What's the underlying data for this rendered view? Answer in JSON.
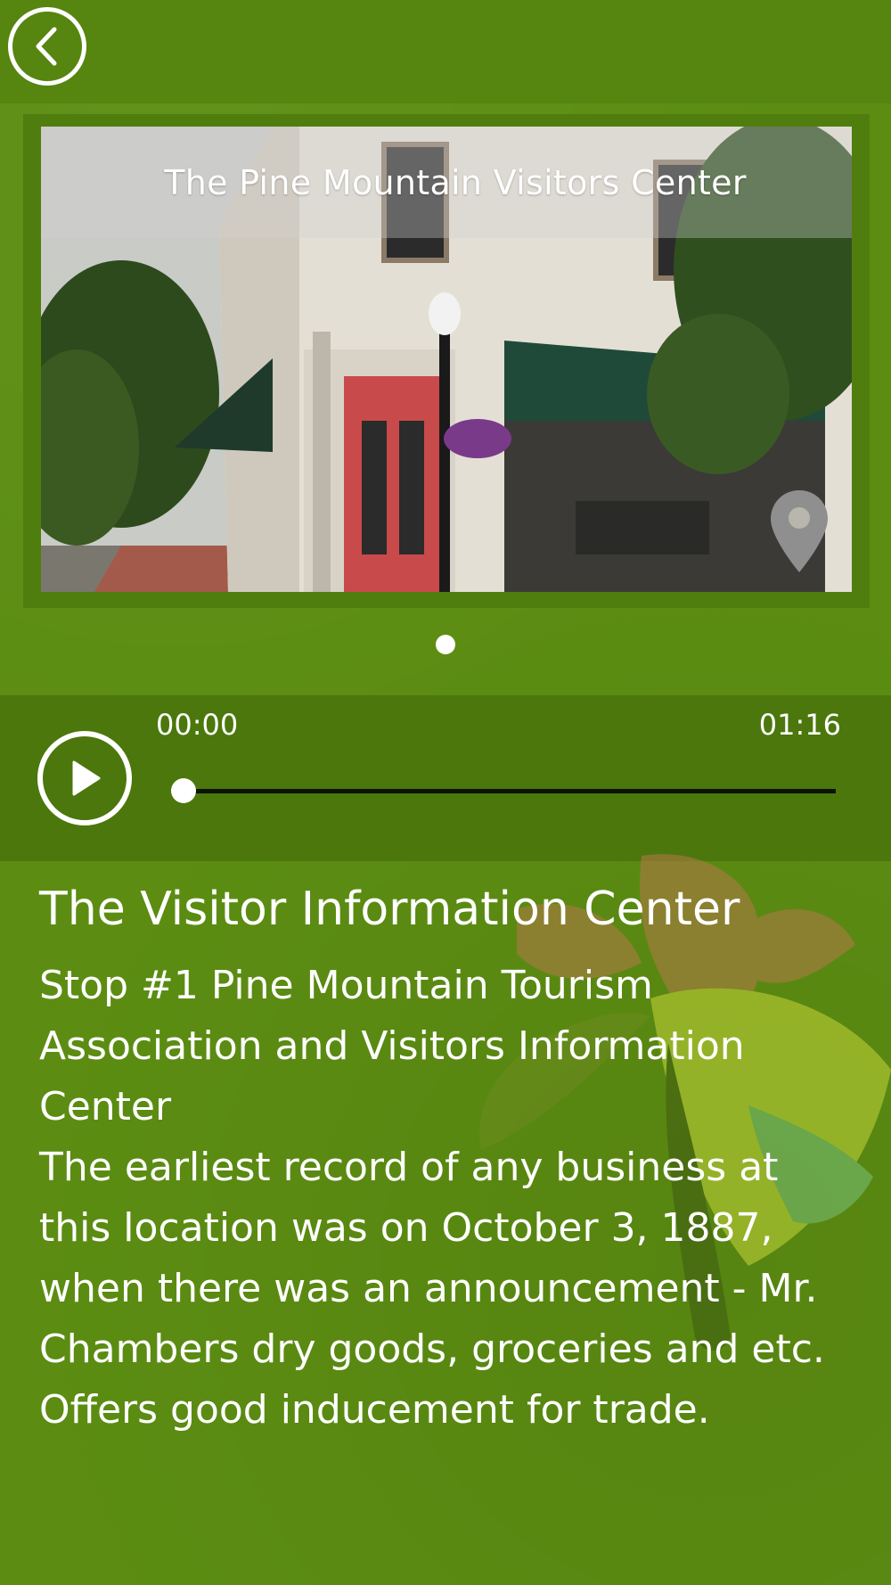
{
  "header": {
    "back_icon": "chevron-left-icon"
  },
  "carousel": {
    "caption": "The Pine Mountain Visitors Center",
    "map_icon": "map-pin-icon",
    "page_count": 1,
    "current_page": 1
  },
  "player": {
    "current_time": "00:00",
    "total_time": "01:16",
    "progress": 0,
    "play_icon": "play-icon"
  },
  "content": {
    "title": "The Visitor Information Center",
    "body": "Stop #1 Pine Mountain Tourism Association and Visitors Information Center\nThe earliest record of any business at this location was on October 3, 1887, when there was an announcement - Mr. Chambers dry goods, groceries and etc.  Offers good inducement for trade."
  },
  "colors": {
    "background": "#5c8d12",
    "player_bar": "#4b770c",
    "accent_white": "#ffffff"
  }
}
